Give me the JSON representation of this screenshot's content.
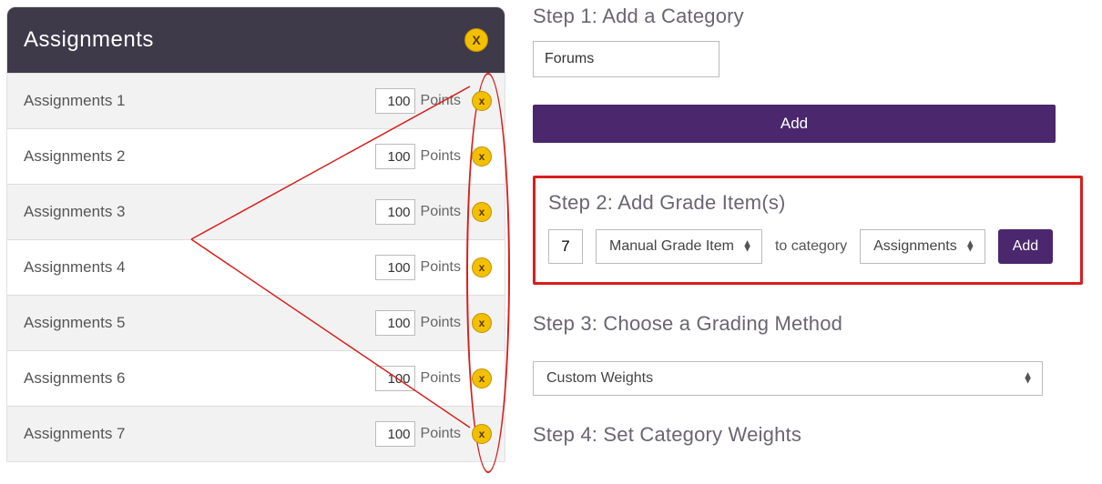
{
  "category": {
    "title": "Assignments",
    "delete_label": "X",
    "items": [
      {
        "name": "Assignments 1",
        "points": "100",
        "unit": "Points",
        "del": "x"
      },
      {
        "name": "Assignments 2",
        "points": "100",
        "unit": "Points",
        "del": "x"
      },
      {
        "name": "Assignments 3",
        "points": "100",
        "unit": "Points",
        "del": "x"
      },
      {
        "name": "Assignments 4",
        "points": "100",
        "unit": "Points",
        "del": "x"
      },
      {
        "name": "Assignments 5",
        "points": "100",
        "unit": "Points",
        "del": "x"
      },
      {
        "name": "Assignments 6",
        "points": "100",
        "unit": "Points",
        "del": "x"
      },
      {
        "name": "Assignments 7",
        "points": "100",
        "unit": "Points",
        "del": "x"
      }
    ]
  },
  "step1": {
    "heading": "Step 1: Add a Category",
    "value": "Forums",
    "add_label": "Add"
  },
  "step2": {
    "heading": "Step 2: Add Grade Item(s)",
    "count": "7",
    "item_type": "Manual Grade Item",
    "to_category_label": "to category",
    "category": "Assignments",
    "add_label": "Add"
  },
  "step3": {
    "heading": "Step 3: Choose a Grading Method",
    "value": "Custom Weights"
  },
  "step4": {
    "heading": "Step 4: Set Category Weights"
  },
  "colors": {
    "accent": "#4b276e",
    "header_bg": "#3f3a4a",
    "delete_bg": "#f2c000",
    "annotation": "#d81e1e"
  }
}
